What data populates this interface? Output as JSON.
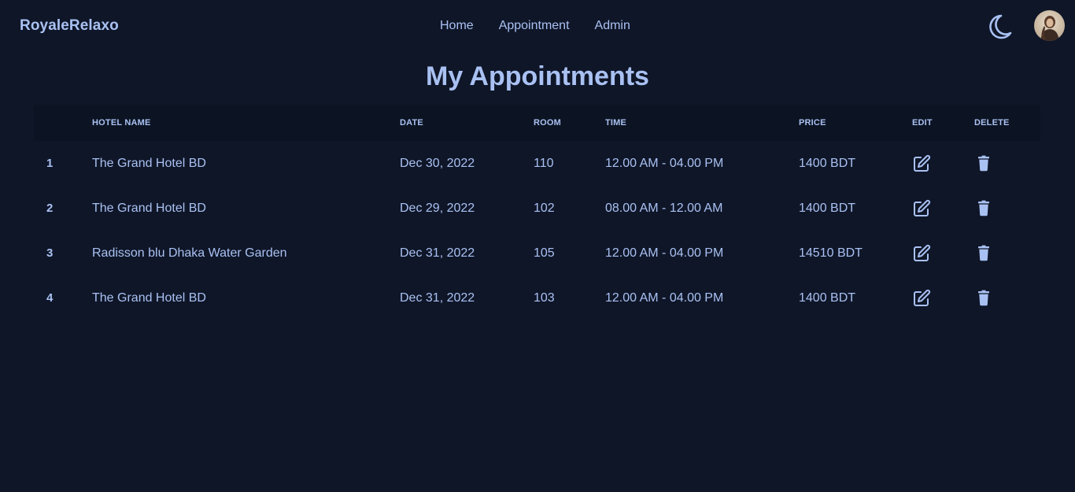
{
  "brand": "RoyaleRelaxo",
  "nav": {
    "items": [
      "Home",
      "Appointment",
      "Admin"
    ]
  },
  "icons": {
    "theme": "moon-icon",
    "avatar": "user-avatar",
    "edit": "edit-icon",
    "delete": "trash-icon"
  },
  "colors": {
    "background": "#0f1628",
    "header_row": "#0c1322",
    "text": "#a9c1f2"
  },
  "page_title": "My Appointments",
  "table": {
    "headers": [
      "",
      "Hotel Name",
      "Date",
      "Room",
      "Time",
      "Price",
      "Edit",
      "Delete"
    ],
    "rows": [
      {
        "index": "1",
        "hotel": "The Grand Hotel BD",
        "date": "Dec 30, 2022",
        "room": "110",
        "time": "12.00 AM - 04.00 PM",
        "price": "1400 BDT"
      },
      {
        "index": "2",
        "hotel": "The Grand Hotel BD",
        "date": "Dec 29, 2022",
        "room": "102",
        "time": "08.00 AM - 12.00 AM",
        "price": "1400 BDT"
      },
      {
        "index": "3",
        "hotel": "Radisson blu Dhaka Water Garden",
        "date": "Dec 31, 2022",
        "room": "105",
        "time": "12.00 AM - 04.00 PM",
        "price": "14510 BDT"
      },
      {
        "index": "4",
        "hotel": "The Grand Hotel BD",
        "date": "Dec 31, 2022",
        "room": "103",
        "time": "12.00 AM - 04.00 PM",
        "price": "1400 BDT"
      }
    ]
  }
}
